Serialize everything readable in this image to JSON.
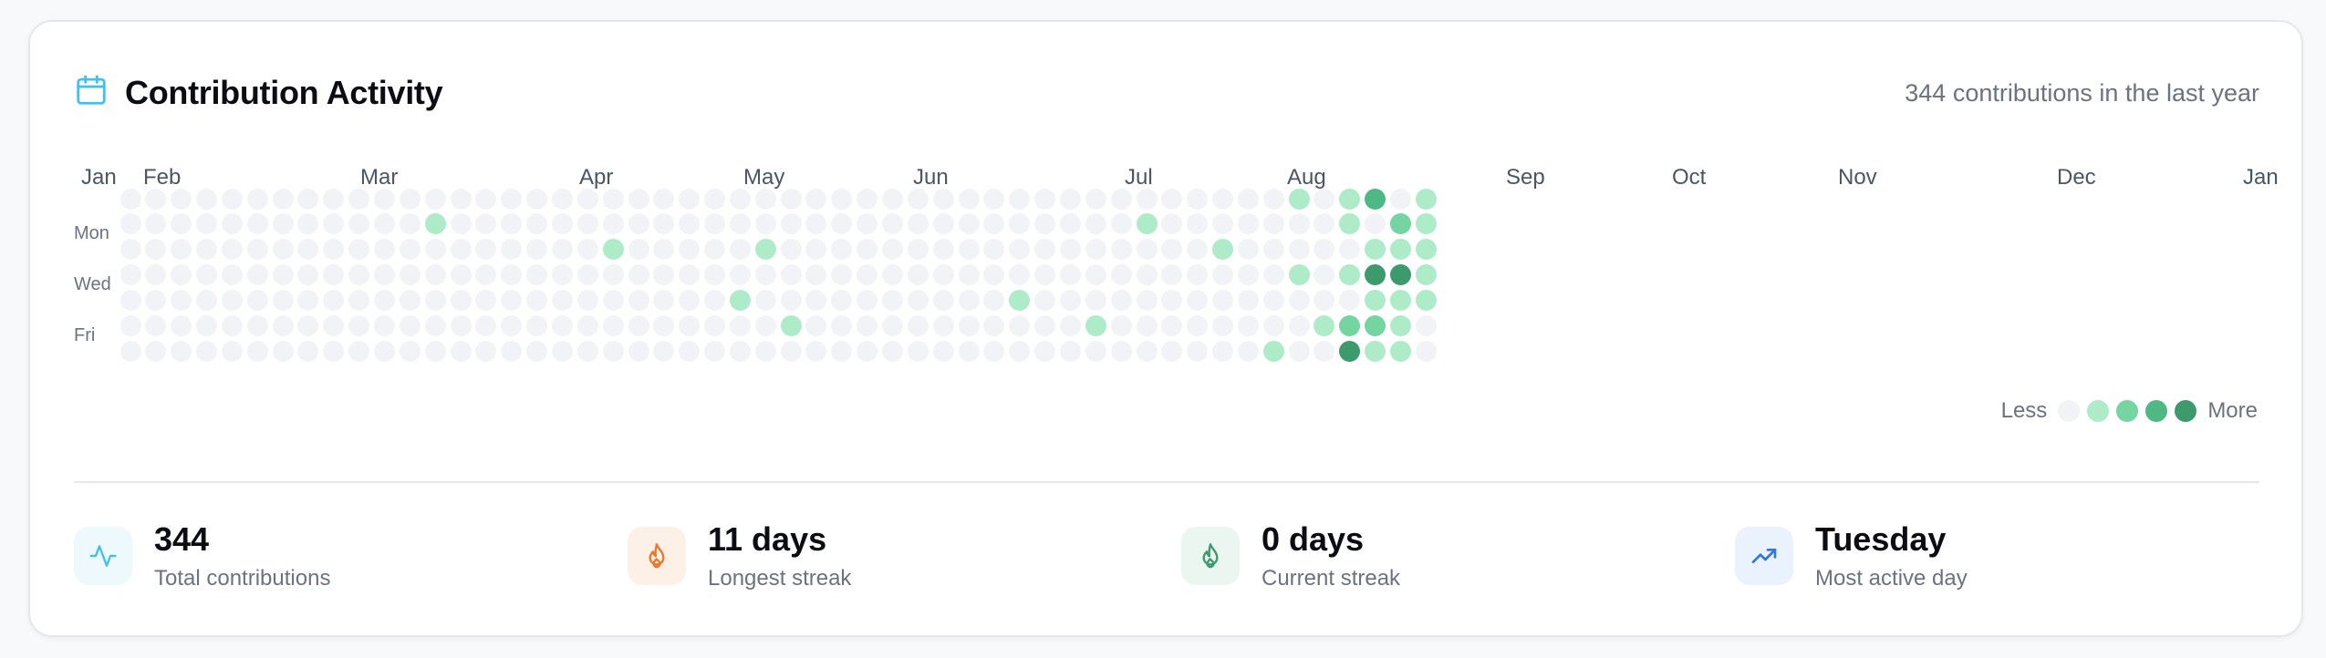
{
  "header": {
    "title": "Contribution Activity",
    "summary": "344 contributions in the last year",
    "icon": "calendar-icon"
  },
  "months": [
    "Jan",
    "Feb",
    "Mar",
    "Apr",
    "May",
    "Jun",
    "Jul",
    "Aug",
    "Sep",
    "Oct",
    "Nov",
    "Dec",
    "Jan"
  ],
  "day_labels": [
    "Mon",
    "Wed",
    "Fri"
  ],
  "heatmap": {
    "weeks_shown": 52,
    "levels": [
      [
        0,
        0,
        0,
        0,
        0,
        0,
        0
      ],
      [
        0,
        0,
        0,
        0,
        0,
        0,
        0
      ],
      [
        0,
        0,
        0,
        0,
        0,
        0,
        0
      ],
      [
        0,
        0,
        0,
        0,
        0,
        0,
        0
      ],
      [
        0,
        0,
        0,
        0,
        0,
        0,
        0
      ],
      [
        0,
        0,
        0,
        0,
        0,
        0,
        0
      ],
      [
        0,
        0,
        0,
        0,
        0,
        0,
        0
      ],
      [
        0,
        0,
        0,
        0,
        0,
        0,
        0
      ],
      [
        0,
        0,
        0,
        0,
        0,
        0,
        0
      ],
      [
        0,
        0,
        0,
        0,
        0,
        0,
        0
      ],
      [
        0,
        0,
        0,
        0,
        0,
        0,
        0
      ],
      [
        0,
        0,
        0,
        0,
        0,
        0,
        0
      ],
      [
        0,
        1,
        0,
        0,
        0,
        0,
        0
      ],
      [
        0,
        0,
        0,
        0,
        0,
        0,
        0
      ],
      [
        0,
        0,
        0,
        0,
        0,
        0,
        0
      ],
      [
        0,
        0,
        0,
        0,
        0,
        0,
        0
      ],
      [
        0,
        0,
        0,
        0,
        0,
        0,
        0
      ],
      [
        0,
        0,
        0,
        0,
        0,
        0,
        0
      ],
      [
        0,
        0,
        0,
        0,
        0,
        0,
        0
      ],
      [
        0,
        0,
        1,
        0,
        0,
        0,
        0
      ],
      [
        0,
        0,
        0,
        0,
        0,
        0,
        0
      ],
      [
        0,
        0,
        0,
        0,
        0,
        0,
        0
      ],
      [
        0,
        0,
        0,
        0,
        0,
        0,
        0
      ],
      [
        0,
        0,
        0,
        0,
        0,
        0,
        0
      ],
      [
        0,
        0,
        0,
        0,
        1,
        0,
        0
      ],
      [
        0,
        0,
        1,
        0,
        0,
        0,
        0
      ],
      [
        0,
        0,
        0,
        0,
        0,
        1,
        0
      ],
      [
        0,
        0,
        0,
        0,
        0,
        0,
        0
      ],
      [
        0,
        0,
        0,
        0,
        0,
        0,
        0
      ],
      [
        0,
        0,
        0,
        0,
        0,
        0,
        0
      ],
      [
        0,
        0,
        0,
        0,
        0,
        0,
        0
      ],
      [
        0,
        0,
        0,
        0,
        0,
        0,
        0
      ],
      [
        0,
        0,
        0,
        0,
        0,
        0,
        0
      ],
      [
        0,
        0,
        0,
        0,
        0,
        0,
        0
      ],
      [
        0,
        0,
        0,
        0,
        0,
        0,
        0
      ],
      [
        0,
        0,
        0,
        0,
        1,
        0,
        0
      ],
      [
        0,
        0,
        0,
        0,
        0,
        0,
        0
      ],
      [
        0,
        0,
        0,
        0,
        0,
        0,
        0
      ],
      [
        0,
        0,
        0,
        0,
        0,
        1,
        0
      ],
      [
        0,
        0,
        0,
        0,
        0,
        0,
        0
      ],
      [
        0,
        1,
        0,
        0,
        0,
        0,
        0
      ],
      [
        0,
        0,
        0,
        0,
        0,
        0,
        0
      ],
      [
        0,
        0,
        0,
        0,
        0,
        0,
        0
      ],
      [
        0,
        0,
        1,
        0,
        0,
        0,
        0
      ],
      [
        0,
        0,
        0,
        0,
        0,
        0,
        0
      ],
      [
        0,
        0,
        0,
        0,
        0,
        0,
        1
      ],
      [
        1,
        0,
        0,
        1,
        0,
        0,
        0
      ],
      [
        0,
        0,
        0,
        0,
        0,
        1,
        0
      ],
      [
        1,
        1,
        0,
        1,
        0,
        2,
        4
      ],
      [
        3,
        0,
        1,
        4,
        1,
        2,
        1
      ],
      [
        0,
        2,
        1,
        4,
        1,
        1,
        1
      ],
      [
        1,
        1,
        1,
        1,
        1,
        0,
        0
      ]
    ]
  },
  "legend": {
    "less_label": "Less",
    "more_label": "More",
    "colors": [
      "#f1f3f6",
      "#aeebc8",
      "#75d5a0",
      "#4fb985",
      "#3c9a6c"
    ]
  },
  "stats": [
    {
      "value": "344",
      "label": "Total contributions",
      "icon": "activity-icon",
      "bg": "#eef9fd",
      "fg": "#45c1e8"
    },
    {
      "value": "11 days",
      "label": "Longest streak",
      "icon": "flame-icon",
      "bg": "#fdf1e7",
      "fg": "#ea7a2b"
    },
    {
      "value": "0 days",
      "label": "Current streak",
      "icon": "flame-icon",
      "bg": "#eaf6ef",
      "fg": "#3e9a6c"
    },
    {
      "value": "Tuesday",
      "label": "Most active day",
      "icon": "trending-up-icon",
      "bg": "#eaf2fd",
      "fg": "#3276db"
    }
  ],
  "colors": {
    "accent_cyan": "#45c1e8",
    "text_primary": "#0b0d12",
    "text_muted": "#6b7280",
    "border": "#e5e7eb"
  }
}
